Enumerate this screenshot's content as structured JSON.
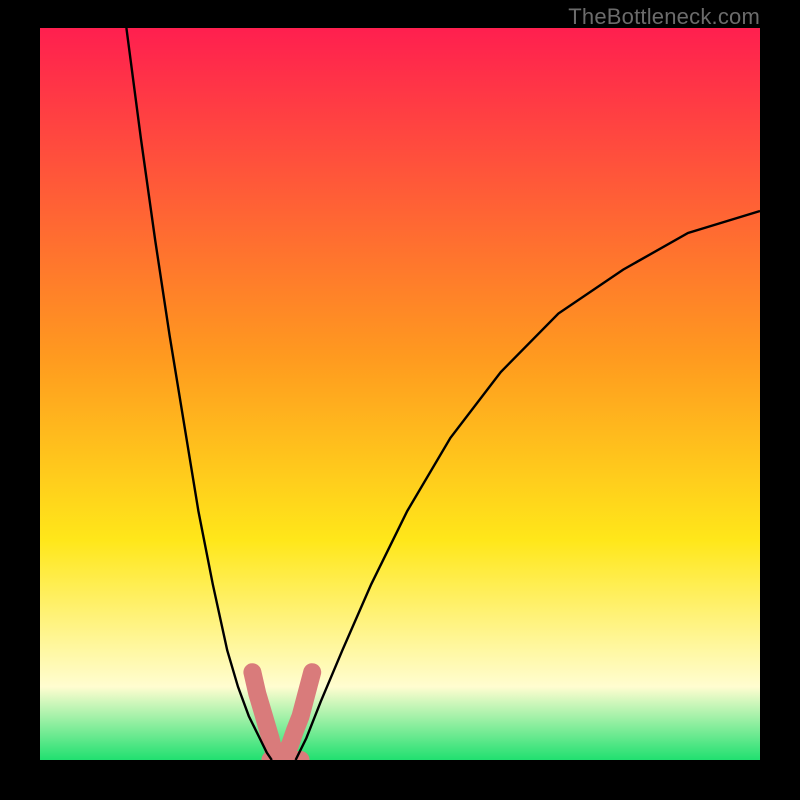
{
  "attribution": "TheBottleneck.com",
  "colors": {
    "gradient_top": "#ff1f4f",
    "gradient_mid1": "#ff9a1f",
    "gradient_mid2": "#ffe71a",
    "gradient_mid3": "#fffdd0",
    "gradient_bottom": "#20e070",
    "curve": "#000000",
    "blob": "#d97b7b",
    "frame": "#000000"
  },
  "chart_data": {
    "type": "line",
    "title": "",
    "xlabel": "",
    "ylabel": "",
    "xlim": [
      0,
      100
    ],
    "ylim": [
      0,
      100
    ],
    "series": [
      {
        "name": "curve-left",
        "x": [
          12,
          14,
          16,
          18,
          20,
          22,
          24,
          26,
          27.5,
          29,
          30.5,
          31.5,
          32.2
        ],
        "y": [
          100,
          85,
          71,
          58,
          46,
          34,
          24,
          15,
          10,
          6,
          3,
          1,
          0
        ]
      },
      {
        "name": "curve-right",
        "x": [
          35.5,
          37,
          39,
          42,
          46,
          51,
          57,
          64,
          72,
          81,
          90,
          100
        ],
        "y": [
          0,
          3,
          8,
          15,
          24,
          34,
          44,
          53,
          61,
          67,
          72,
          75
        ]
      },
      {
        "name": "blob-left",
        "x": [
          29.5,
          30.2,
          30.8,
          31.4,
          32.0,
          32.5
        ],
        "y": [
          12,
          9,
          7,
          5,
          3,
          1
        ]
      },
      {
        "name": "blob-right",
        "x": [
          34.0,
          34.7,
          35.4,
          36.2,
          37.0,
          37.8
        ],
        "y": [
          1,
          2,
          4,
          6,
          9,
          12
        ]
      },
      {
        "name": "blob-bottom",
        "x": [
          32.0,
          33.0,
          34.0,
          35.2,
          36.2
        ],
        "y": [
          0,
          0,
          0,
          0,
          0
        ]
      }
    ],
    "grid": false,
    "legend": false
  }
}
